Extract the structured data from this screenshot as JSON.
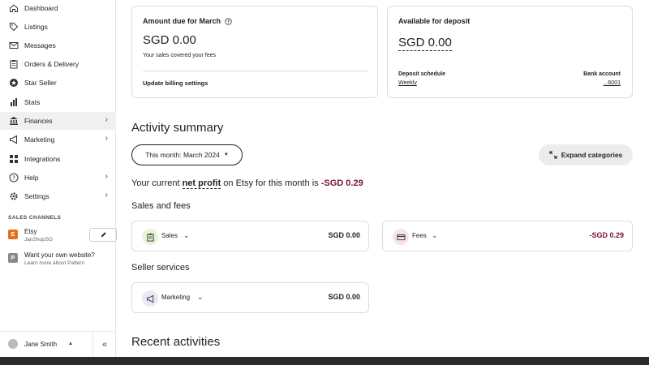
{
  "sidebar": {
    "items": [
      {
        "label": "Dashboard",
        "icon": "home-icon"
      },
      {
        "label": "Listings",
        "icon": "tag-icon"
      },
      {
        "label": "Messages",
        "icon": "mail-icon"
      },
      {
        "label": "Orders & Delivery",
        "icon": "clipboard-icon"
      },
      {
        "label": "Star Seller",
        "icon": "star-badge-icon"
      },
      {
        "label": "Stats",
        "icon": "bar-chart-icon"
      },
      {
        "label": "Finances",
        "icon": "bank-icon"
      },
      {
        "label": "Marketing",
        "icon": "megaphone-icon"
      },
      {
        "label": "Integrations",
        "icon": "grid-icon"
      },
      {
        "label": "Help",
        "icon": "help-circle-icon"
      },
      {
        "label": "Settings",
        "icon": "gear-icon"
      }
    ],
    "sales_channels_label": "SALES CHANNELS",
    "channels": [
      {
        "badge": "E",
        "title": "Etsy",
        "subtitle": "JanShopSG",
        "color": "#e8701a"
      },
      {
        "badge": "P",
        "title": "Want your own website?",
        "subtitle": "Learn more about Pattern",
        "color": "#8a8a8a"
      }
    ],
    "user_name": "Jane Smith"
  },
  "amount_due": {
    "title": "Amount due for March",
    "amount": "SGD 0.00",
    "note": "Your sales covered your fees",
    "link": "Update billing settings"
  },
  "deposit": {
    "title": "Available for deposit",
    "amount": "SGD 0.00",
    "schedule_label": "Deposit schedule",
    "schedule_value": "Weekly",
    "bank_label": "Bank account",
    "bank_value": "...6001"
  },
  "activity": {
    "heading": "Activity summary",
    "month_filter": "This month: March 2024",
    "expand_label": "Expand categories",
    "net_prefix": "Your current ",
    "net_term": "net profit",
    "net_mid": " on Etsy for this month is ",
    "net_value": "-SGD 0.29",
    "sales_fees_heading": "Sales and fees",
    "sales": {
      "label": "Sales",
      "value": "SGD 0.00"
    },
    "fees": {
      "label": "Fees",
      "value": "-SGD 0.29"
    },
    "seller_services_heading": "Seller services",
    "marketing": {
      "label": "Marketing",
      "value": "SGD 0.00"
    },
    "recent_heading": "Recent activities"
  },
  "colors": {
    "negative": "#7a1236",
    "sales_icon_bg": "#e7f5d6",
    "fees_icon_bg": "#f7e3ea",
    "marketing_icon_bg": "#e8e8f6"
  }
}
